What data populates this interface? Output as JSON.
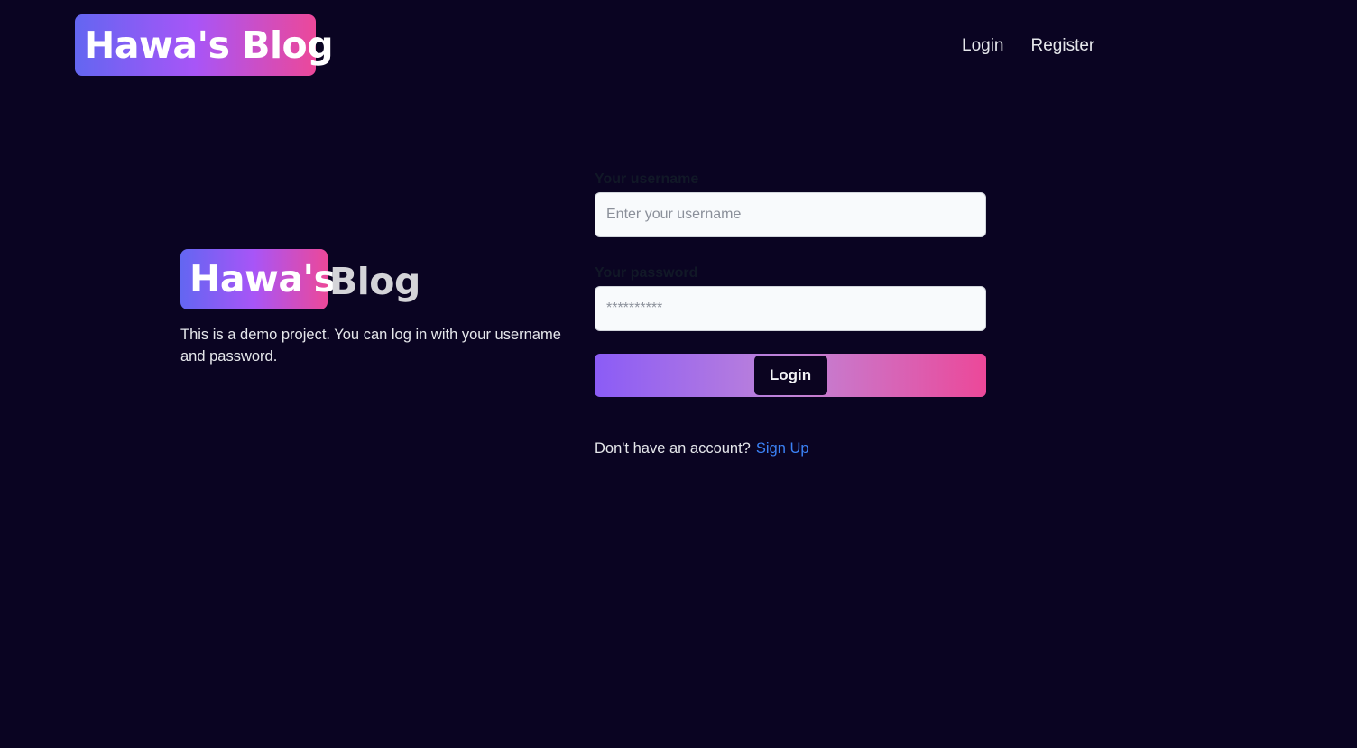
{
  "header": {
    "logo_text": "Hawa's Blog",
    "nav": [
      {
        "label": "Login"
      },
      {
        "label": "Register"
      }
    ]
  },
  "hero": {
    "title_badge": "Hawa's",
    "title_rest": "Blog",
    "description": "This is a demo project. You can log in with your username and password."
  },
  "form": {
    "username_label": "Your username",
    "username_placeholder": "Enter your username",
    "password_label": "Your password",
    "password_placeholder": "**********",
    "submit_label": "Login",
    "signup_prompt": "Don't have an account?",
    "signup_link": "Sign Up"
  },
  "colors": {
    "background": "#0a0422",
    "gradient_start": "#6366f1",
    "gradient_end": "#ec4899",
    "link": "#3b82f6"
  }
}
